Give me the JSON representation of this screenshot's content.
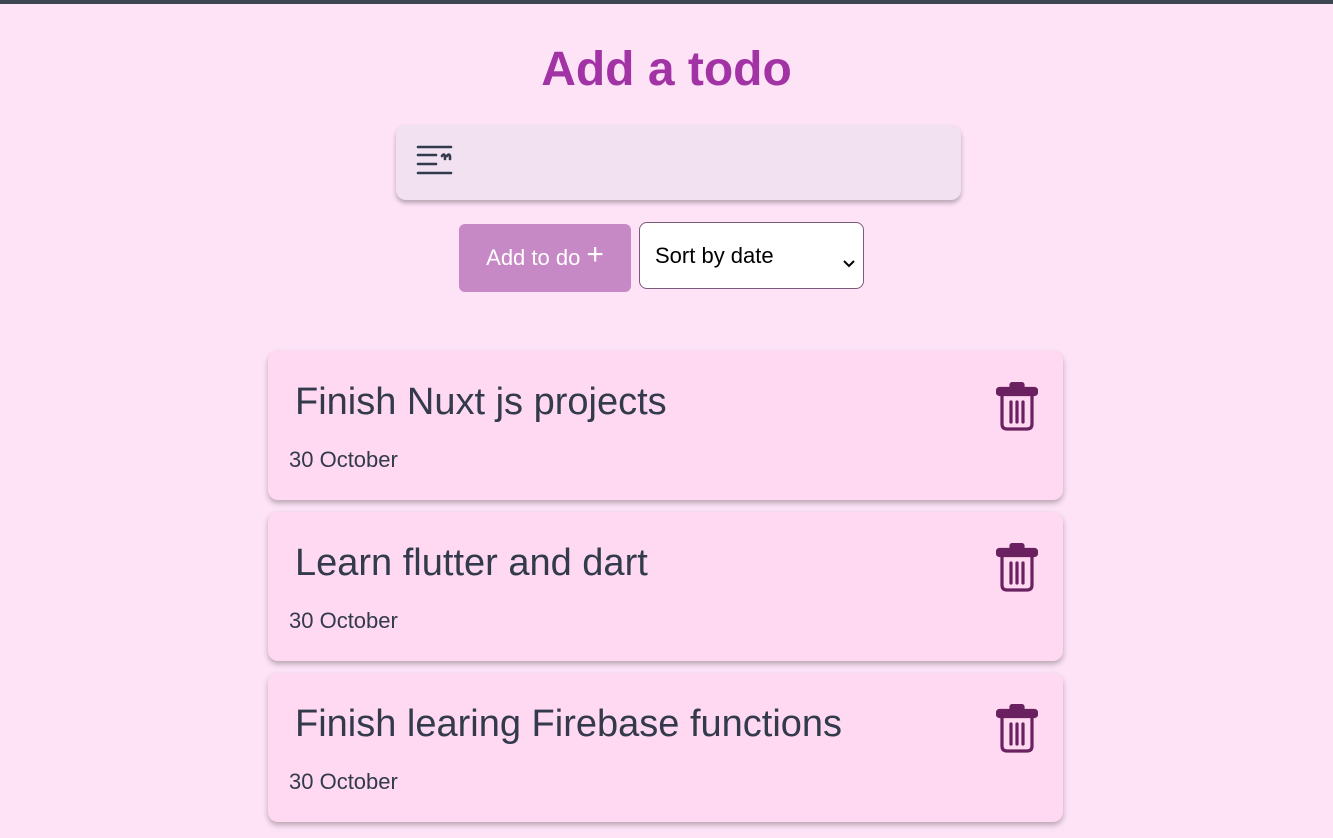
{
  "header": {
    "title": "Add a todo"
  },
  "input": {
    "value": "",
    "placeholder": "",
    "icon": "text-notes-icon"
  },
  "controls": {
    "add_label": "Add to do",
    "add_icon": "+",
    "sort_selected": "Sort by date"
  },
  "todos": [
    {
      "title": "Finish Nuxt js projects",
      "date": "30 October"
    },
    {
      "title": "Learn flutter and dart",
      "date": "30 October"
    },
    {
      "title": "Finish learing Firebase functions",
      "date": "30 October"
    }
  ],
  "colors": {
    "background": "#fee3f7",
    "title": "#a233a5",
    "card": "#ffd8f1",
    "button": "#c789c6",
    "trash_icon": "#6a2160",
    "text": "#323a4c"
  }
}
